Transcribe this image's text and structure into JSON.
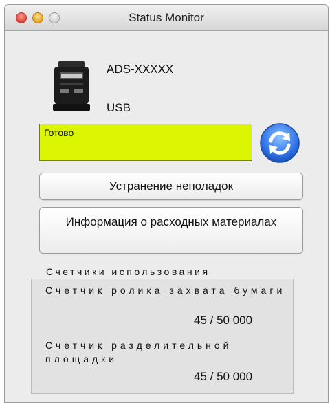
{
  "window": {
    "title": "Status Monitor"
  },
  "device": {
    "name": "ADS-XXXXX",
    "connection": "USB",
    "icon": "scanner-icon"
  },
  "status": {
    "text": "Готово",
    "color": "#dcf500",
    "refresh_icon": "refresh-icon"
  },
  "buttons": {
    "troubleshoot": "Устранение неполадок",
    "supplies": "Информация о расходных материалах"
  },
  "counters": {
    "title": "Счетчики использования",
    "items": [
      {
        "label": "Счетчик ролика захвата бумаги",
        "value": "45 / 50 000"
      },
      {
        "label": "Счетчик разделительной площадки",
        "value": "45 / 50 000"
      }
    ]
  }
}
